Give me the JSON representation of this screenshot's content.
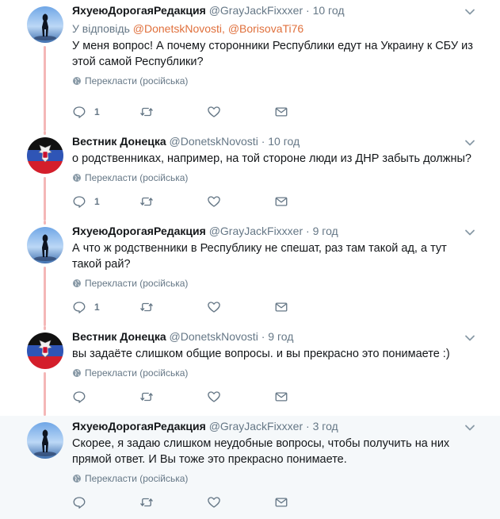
{
  "tweets": [
    {
      "fullname": "ЯхуеюДорогаяРедакция",
      "handle": "@GrayJackFixxxer",
      "separator": "·",
      "time": "10 год",
      "reply_prefix": "У відповідь",
      "reply_mentions": "@DonetskNovosti, @BorisovaTi76",
      "text": "У меня вопрос! А почему сторонники Республики едут на Украину к СБУ из этой самой Республики?",
      "translate": "Перекласти (російська)",
      "reply_count": "1",
      "avatar": "hooded-figure-avatar"
    },
    {
      "fullname": "Вестник Донецка",
      "handle": "@DonetskNovosti",
      "separator": "·",
      "time": "10 год",
      "text": "о родственниках, например, на той стороне люди из ДНР забыть должны?",
      "translate": "Перекласти (російська)",
      "reply_count": "1",
      "avatar": "dnr-flag-avatar"
    },
    {
      "fullname": "ЯхуеюДорогаяРедакция",
      "handle": "@GrayJackFixxxer",
      "separator": "·",
      "time": "9 год",
      "text": "А что ж родственники в Республику не спешат, раз там такой ад, а тут такой рай?",
      "translate": "Перекласти (російська)",
      "reply_count": "1",
      "avatar": "hooded-figure-avatar"
    },
    {
      "fullname": "Вестник Донецка",
      "handle": "@DonetskNovosti",
      "separator": "·",
      "time": "9 год",
      "text": "вы задаёте слишком общие вопросы. и вы прекрасно это понимаете :)",
      "translate": "Перекласти (російська)",
      "reply_count": "",
      "avatar": "dnr-flag-avatar"
    },
    {
      "fullname": "ЯхуеюДорогаяРедакция",
      "handle": "@GrayJackFixxxer",
      "separator": "·",
      "time": "3 год",
      "text": "Скорее, я задаю слишком неудобные вопросы, чтобы получить на них прямой ответ. И Вы тоже это прекрасно понимаете.",
      "translate": "Перекласти (російська)",
      "reply_count": "",
      "avatar": "hooded-figure-avatar"
    }
  ],
  "colors": {
    "mention": "#e0703c",
    "muted": "#657786",
    "thread_line": "#f4b7b7",
    "highlight_bg": "#f5f8fa"
  }
}
